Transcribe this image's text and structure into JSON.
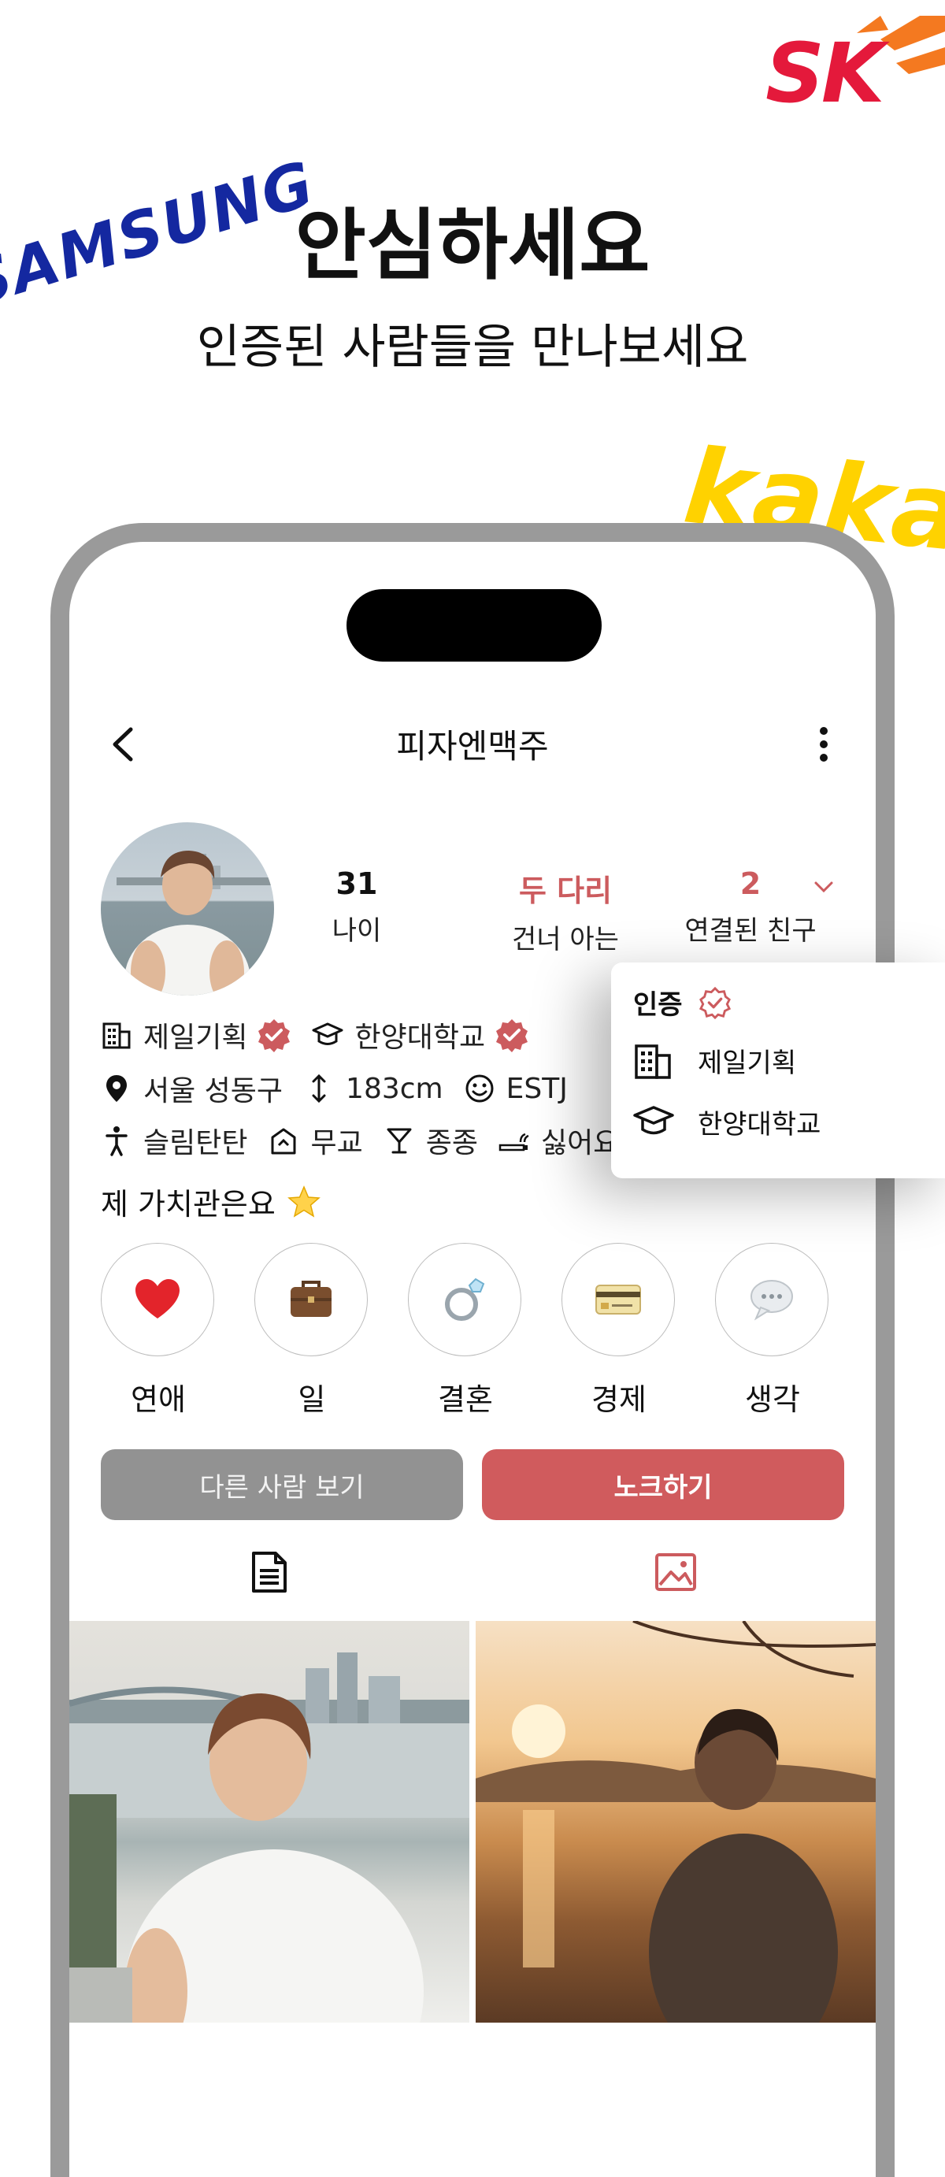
{
  "marketing": {
    "headline": "안심하세요",
    "subheadline": "인증된 사람들을 만나보세요",
    "logos": [
      "SAMSUNG",
      "SK",
      "kakao"
    ]
  },
  "topbar": {
    "title": "피자엔맥주"
  },
  "profile": {
    "stats": [
      {
        "value": "31",
        "label": "나이"
      },
      {
        "value": "두 다리",
        "label": "건너 아는"
      },
      {
        "value": "2",
        "label": "연결된 친구"
      }
    ],
    "company": "제일기획",
    "school": "한양대학교",
    "location": "서울 성동구",
    "height": "183cm",
    "mbti": "ESTJ",
    "body_type": "슬림탄탄",
    "religion": "무교",
    "drinking": "종종",
    "smoking": "싫어요"
  },
  "values": {
    "title": "제 가치관은요",
    "items": [
      {
        "label": "연애",
        "icon": "heart-icon"
      },
      {
        "label": "일",
        "icon": "briefcase-icon"
      },
      {
        "label": "결혼",
        "icon": "ring-icon"
      },
      {
        "label": "경제",
        "icon": "credit-card-icon"
      },
      {
        "label": "생각",
        "icon": "speech-bubble-icon"
      }
    ]
  },
  "buttons": {
    "next": "다른 사람 보기",
    "knock": "노크하기"
  },
  "verification_popup": {
    "title": "인증",
    "items": [
      "제일기획",
      "한양대학교"
    ]
  },
  "colors": {
    "accent": "#d05b5d",
    "secondary_button": "#929292",
    "frame": "#9a9a9a"
  }
}
